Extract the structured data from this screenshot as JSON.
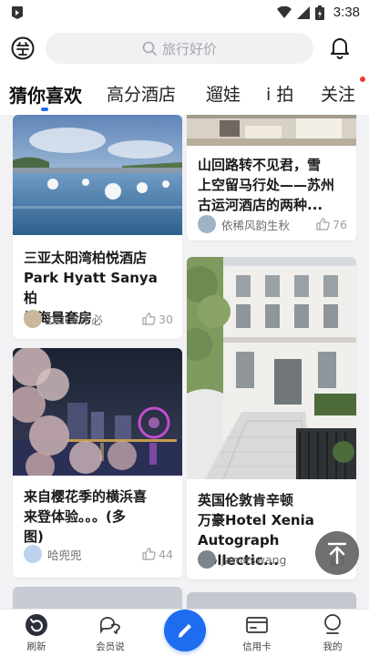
{
  "status_bar": {
    "time": "3:38"
  },
  "header": {
    "search_placeholder": "旅行好价"
  },
  "tabs": [
    {
      "label": "猜你喜欢",
      "active": true
    },
    {
      "label": "高分酒店"
    },
    {
      "label": "遛娃"
    },
    {
      "label": "i 拍"
    },
    {
      "label": "关注",
      "has_dot": true
    }
  ],
  "feed": {
    "left": [
      {
        "title": "三亚太阳湾柏悦酒店\nPark Hyatt Sanya 柏\n悦海景套房",
        "author": "DUCK不必",
        "likes": "30"
      },
      {
        "title": "来自樱花季的横浜喜\n来登体验。。。(多\n图)",
        "author": "哈兜兜",
        "likes": "44"
      }
    ],
    "right": [
      {
        "title": "山回路转不见君，雪\n上空留马行处——苏州\n古运河酒店的两种...",
        "author": "依稀风韵生秋",
        "likes": "76"
      },
      {
        "title": "英国伦敦肯辛顿\n万豪Hotel Xenia\nAutograph Collectic...",
        "author": "Jameswang",
        "likes": ""
      }
    ]
  },
  "bottom_nav": [
    {
      "label": "刷新",
      "icon": "refresh-icon"
    },
    {
      "label": "会员说",
      "icon": "chat-bubbles-icon"
    },
    {
      "label": "",
      "icon": "pencil-icon"
    },
    {
      "label": "信用卡",
      "icon": "credit-card-icon"
    },
    {
      "label": "我的",
      "icon": "profile-icon"
    }
  ],
  "colors": {
    "accent": "#1e6cf0",
    "notification_dot": "#f23a3a"
  }
}
